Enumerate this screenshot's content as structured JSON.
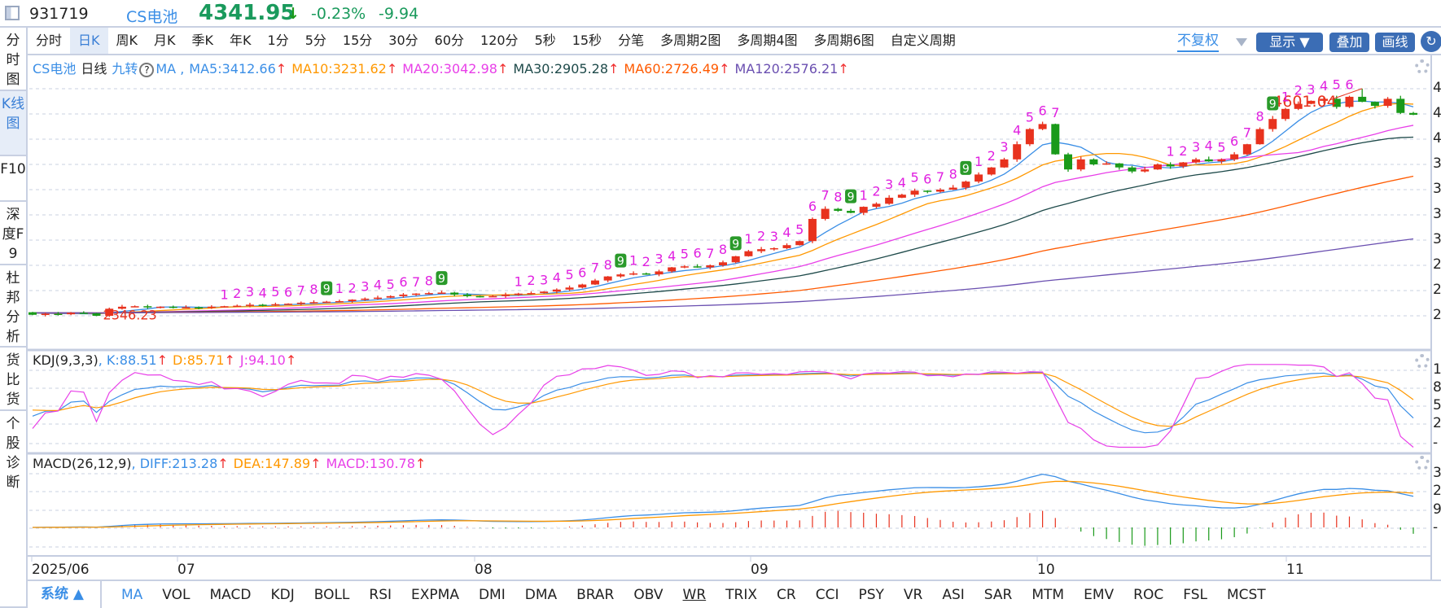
{
  "header": {
    "code": "931719",
    "name": "CS电池",
    "price": "4341.95",
    "arrow": "↓",
    "pct": "-0.23%",
    "change": "-9.94"
  },
  "period_tabs": [
    "分时",
    "日K",
    "周K",
    "月K",
    "季K",
    "年K",
    "1分",
    "5分",
    "15分",
    "30分",
    "60分",
    "120分",
    "5秒",
    "15秒",
    "分笔",
    "多周期2图",
    "多周期4图",
    "多周期6图",
    "自定义周期"
  ],
  "selected_period": "日K",
  "toolbar": {
    "adjust": "不复权",
    "display": "显示",
    "overlay": "叠加",
    "draw": "画线"
  },
  "sidebar": [
    "分时图",
    "K线图",
    "F10",
    "深度F9",
    "杜邦分析",
    "货比货",
    "个股诊断"
  ],
  "main_legend": {
    "name": "CS电池",
    "period": "日线",
    "nine": "九转",
    "help": "?",
    "ma": "MA ,",
    "ma5": "MA5:3412.66",
    "ma10": "MA10:3231.62",
    "ma20": "MA20:3042.98",
    "ma30": "MA30:2905.28",
    "ma60": "MA60:2726.49",
    "ma120": "MA120:2576.21",
    "up": "↑"
  },
  "kdj_legend": {
    "name": "KDJ(9,3,3)",
    "k": ", K:88.51",
    "d": "D:85.71",
    "j": "J:94.10",
    "up": "↑"
  },
  "macd_legend": {
    "name": "MACD(26,12,9)",
    "diff": ", DIFF:213.28",
    "dea": "DEA:147.89",
    "macd": "MACD:130.78",
    "up": "↑"
  },
  "axis": {
    "main": [
      "4",
      "4",
      "4",
      "3",
      "3",
      "3",
      "3",
      "2",
      "2",
      "2"
    ],
    "kdj": [
      "1",
      "8",
      "5",
      "2",
      "-"
    ],
    "macd": [
      "3",
      "2",
      "9",
      "-"
    ]
  },
  "dates": [
    "2025/06",
    "07",
    "08",
    "09",
    "10",
    "11"
  ],
  "indicator_tabs": {
    "system": "系统 ▲",
    "items": [
      "MA",
      "VOL",
      "MACD",
      "KDJ",
      "BOLL",
      "RSI",
      "EXPMA",
      "DMI",
      "DMA",
      "BRAR",
      "OBV",
      "WR",
      "TRIX",
      "CR",
      "CCI",
      "PSY",
      "VR",
      "ASI",
      "SAR",
      "MTM",
      "EMV",
      "ROC",
      "FSL",
      "MCST"
    ]
  },
  "colors": {
    "up": "#e8321e",
    "down": "#1a9a1a",
    "ma5": "#3a8ee6",
    "ma10": "#ff9800",
    "ma20": "#e83fe8",
    "ma30": "#1e4a4a",
    "ma60": "#ff5a00",
    "ma120": "#6a4fb0",
    "accent": "#3a7fd6"
  },
  "chart_data": {
    "type": "candlestick",
    "closes": [
      2360,
      2370,
      2365,
      2380,
      2375,
      2350,
      2420,
      2440,
      2445,
      2435,
      2440,
      2430,
      2435,
      2430,
      2440,
      2445,
      2450,
      2460,
      2455,
      2465,
      2470,
      2480,
      2485,
      2490,
      2495,
      2510,
      2520,
      2530,
      2545,
      2560,
      2570,
      2575,
      2580,
      2560,
      2545,
      2540,
      2545,
      2560,
      2570,
      2575,
      2590,
      2610,
      2630,
      2660,
      2700,
      2740,
      2760,
      2770,
      2760,
      2790,
      2830,
      2840,
      2830,
      2850,
      2880,
      2940,
      2990,
      3010,
      3020,
      3050,
      3090,
      3310,
      3410,
      3390,
      3370,
      3430,
      3460,
      3520,
      3550,
      3590,
      3580,
      3600,
      3620,
      3680,
      3750,
      3820,
      3900,
      4050,
      4200,
      4250,
      3950,
      3800,
      3900,
      3850,
      3860,
      3820,
      3780,
      3800,
      3850,
      3830,
      3870,
      3900,
      3880,
      3900,
      3950,
      4050,
      4200,
      4300,
      4400,
      4450,
      4480,
      4500,
      4420,
      4520,
      4470,
      4430,
      4500,
      4360,
      4341.95
    ],
    "low_label": "2346.23",
    "high_label": "4601.04",
    "low_value": 2346.23,
    "high_value": 4601.04,
    "price_range": [
      2350,
      4600
    ],
    "ma_periods": [
      5,
      10,
      20,
      30,
      60,
      120
    ],
    "kdj": [
      9,
      3,
      3
    ],
    "macd": [
      26,
      12,
      9
    ]
  }
}
